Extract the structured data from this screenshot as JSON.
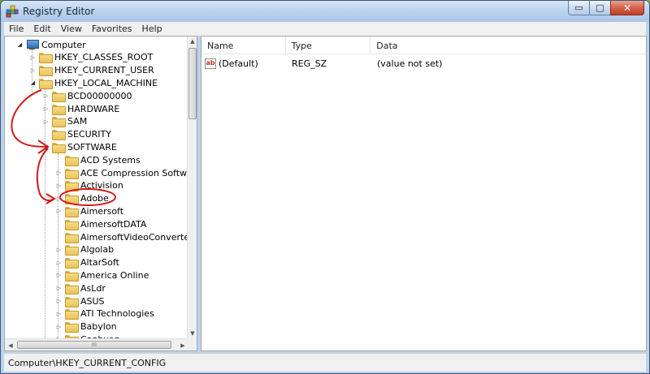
{
  "window": {
    "title": "Registry Editor",
    "caption_minimize": "▭",
    "caption_maximize": "□",
    "caption_close": "✕"
  },
  "menu": {
    "items": [
      "File",
      "Edit",
      "View",
      "Favorites",
      "Help"
    ]
  },
  "tree": {
    "nodes": [
      {
        "label": "Computer",
        "icon": "computer-icon",
        "expander": "open"
      },
      {
        "label": "HKEY_CLASSES_ROOT",
        "icon": "folder-icon",
        "expander": "closed"
      },
      {
        "label": "HKEY_CURRENT_USER",
        "icon": "folder-icon",
        "expander": "closed"
      },
      {
        "label": "HKEY_LOCAL_MACHINE",
        "icon": "folder-icon",
        "expander": "open"
      },
      {
        "label": "BCD00000000",
        "icon": "folder-icon",
        "expander": "closed"
      },
      {
        "label": "HARDWARE",
        "icon": "folder-icon",
        "expander": "closed"
      },
      {
        "label": "SAM",
        "icon": "folder-icon",
        "expander": "closed"
      },
      {
        "label": "SECURITY",
        "icon": "folder-icon",
        "expander": "none"
      },
      {
        "label": "SOFTWARE",
        "icon": "folder-icon",
        "expander": "open"
      },
      {
        "label": "ACD Systems",
        "icon": "folder-icon",
        "expander": "none"
      },
      {
        "label": "ACE Compression Software",
        "icon": "folder-icon",
        "expander": "closed"
      },
      {
        "label": "Activision",
        "icon": "folder-icon",
        "expander": "closed"
      },
      {
        "label": "Adobe",
        "icon": "folder-icon",
        "expander": "closed"
      },
      {
        "label": "Aimersoft",
        "icon": "folder-icon",
        "expander": "closed"
      },
      {
        "label": "AimersoftDATA",
        "icon": "folder-icon",
        "expander": "none"
      },
      {
        "label": "AimersoftVideoConverterDA",
        "icon": "folder-icon",
        "expander": "none"
      },
      {
        "label": "Algolab",
        "icon": "folder-icon",
        "expander": "closed"
      },
      {
        "label": "AltarSoft",
        "icon": "folder-icon",
        "expander": "closed"
      },
      {
        "label": "America Online",
        "icon": "folder-icon",
        "expander": "closed"
      },
      {
        "label": "AsLdr",
        "icon": "folder-icon",
        "expander": "closed"
      },
      {
        "label": "ASUS",
        "icon": "folder-icon",
        "expander": "closed"
      },
      {
        "label": "ATI Technologies",
        "icon": "folder-icon",
        "expander": "closed"
      },
      {
        "label": "Babylon",
        "icon": "folder-icon",
        "expander": "closed"
      },
      {
        "label": "Canhyon",
        "icon": "folder-icon",
        "expander": "closed"
      }
    ]
  },
  "scroll": {
    "up_arrow": "▲",
    "down_arrow": "▼",
    "left_arrow": "◀",
    "right_arrow": "▶",
    "h_thumb_grip": "III"
  },
  "list": {
    "columns": [
      "Name",
      "Type",
      "Data"
    ],
    "rows": [
      {
        "name": "(Default)",
        "type": "REG_SZ",
        "data": "(value not set)",
        "icon_text": "ab"
      }
    ]
  },
  "status": {
    "path": "Computer\\HKEY_CURRENT_CONFIG"
  },
  "colors": {
    "annotation": "#d41a1a",
    "titlebar": "#bcd3ec"
  }
}
